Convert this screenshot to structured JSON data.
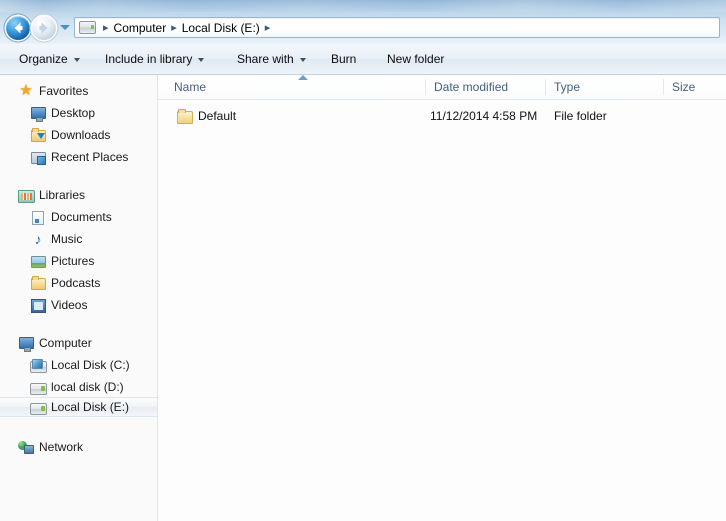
{
  "window": {
    "title": "Local Disk (E:)"
  },
  "navbar": {
    "back_icon": "back-arrow-icon",
    "forward_icon": "forward-arrow-icon",
    "history_dropdown_icon": "chevron-down-icon",
    "drive_icon": "drive-icon",
    "breadcrumbs": [
      {
        "label": "Computer"
      },
      {
        "label": "Local Disk (E:)"
      }
    ],
    "separator": "▸"
  },
  "toolbar": {
    "items": [
      {
        "label": "Organize",
        "has_caret": true
      },
      {
        "label": "Include in library",
        "has_caret": true
      },
      {
        "label": "Share with",
        "has_caret": true
      },
      {
        "label": "Burn",
        "has_caret": false
      },
      {
        "label": "New folder",
        "has_caret": false
      }
    ]
  },
  "sidebar": {
    "groups": [
      {
        "header": {
          "label": "Favorites",
          "icon": "star-icon"
        },
        "items": [
          {
            "label": "Desktop",
            "icon": "desktop-icon"
          },
          {
            "label": "Downloads",
            "icon": "downloads-icon"
          },
          {
            "label": "Recent Places",
            "icon": "recent-places-icon"
          }
        ]
      },
      {
        "header": {
          "label": "Libraries",
          "icon": "libraries-icon"
        },
        "items": [
          {
            "label": "Documents",
            "icon": "document-icon"
          },
          {
            "label": "Music",
            "icon": "music-note-icon"
          },
          {
            "label": "Pictures",
            "icon": "picture-icon"
          },
          {
            "label": "Podcasts",
            "icon": "folder-icon"
          },
          {
            "label": "Videos",
            "icon": "video-icon"
          }
        ]
      },
      {
        "header": {
          "label": "Computer",
          "icon": "computer-icon"
        },
        "items": [
          {
            "label": "Local Disk (C:)",
            "icon": "system-drive-icon",
            "selected": false
          },
          {
            "label": "local disk (D:)",
            "icon": "drive-icon",
            "selected": false
          },
          {
            "label": "Local Disk (E:)",
            "icon": "drive-icon",
            "selected": true
          }
        ]
      },
      {
        "header": {
          "label": "Network",
          "icon": "network-icon"
        },
        "items": []
      }
    ]
  },
  "content": {
    "columns": [
      {
        "label": "Name"
      },
      {
        "label": "Date modified"
      },
      {
        "label": "Type"
      },
      {
        "label": "Size"
      }
    ],
    "sort": {
      "column": "Name",
      "direction": "ascending",
      "icon": "sort-ascending-icon"
    },
    "rows": [
      {
        "icon": "folder-icon",
        "name": "Default",
        "date_modified": "11/12/2014 4:58 PM",
        "type": "File folder",
        "size": ""
      }
    ]
  },
  "colors": {
    "glass_blue": "#a3c3de",
    "navbar_blue": "#cfe2f1",
    "column_header_text": "#44617d",
    "accent_green": "#7dc242",
    "star_gold": "#f5a623"
  }
}
